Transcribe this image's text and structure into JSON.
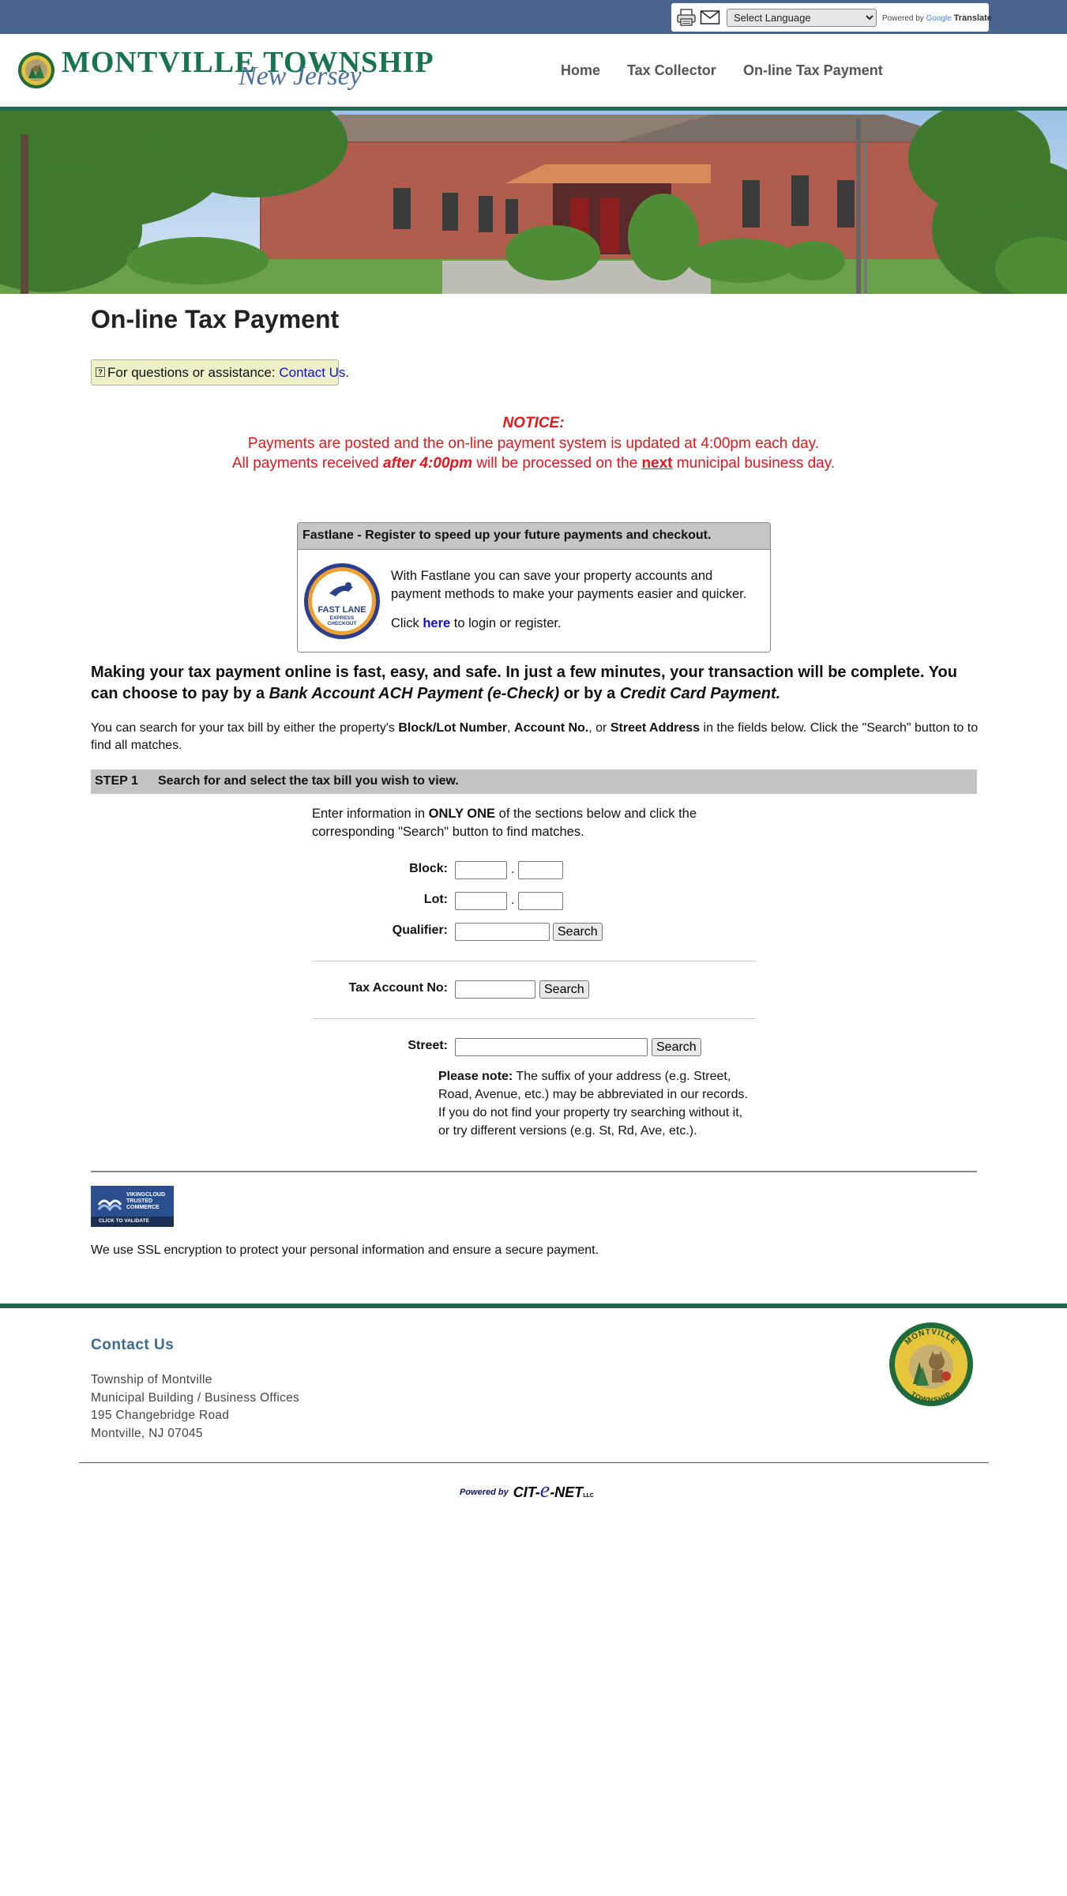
{
  "translate": {
    "language_select": "Select Language",
    "powered_by": "Powered by",
    "google": "Google",
    "translate_label": "Translate"
  },
  "header": {
    "logo_title": "MONTVILLE TOWNSHIP",
    "logo_subtitle": "New Jersey",
    "nav": [
      "Home",
      "Tax Collector",
      "On-line Tax Payment"
    ]
  },
  "page_title": "On-line Tax Payment",
  "help": {
    "icon": "?",
    "text": "For questions or assistance:",
    "link": "Contact Us."
  },
  "notice": {
    "heading": "NOTICE:",
    "line1": "Payments are posted and the on-line payment system is updated at 4:00pm each day.",
    "line2_part1": "All payments received",
    "line2_em": "after 4:00pm",
    "line2_part2": "will be processed on the",
    "line2_next": "next",
    "line2_part3": "municipal business day."
  },
  "fastlane": {
    "heading": "Fastlane - Register to speed up your future payments and checkout.",
    "logo_line1": "FAST LANE",
    "logo_line2": "EXPRESS",
    "logo_line3": "CHECKOUT",
    "body": "With Fastlane you can save your property accounts and payment methods to make your payments easier and quicker.",
    "click_pre": "Click",
    "click_link": "here",
    "click_post": "to login or register."
  },
  "intro": {
    "part1": "Making your tax payment online is fast, easy, and safe. In just a few minutes, your transaction will be complete. You can choose to pay by a",
    "ach": "Bank Account ACH Payment (e-Check)",
    "part2": "or by a",
    "cc": "Credit Card Payment."
  },
  "search_info": {
    "part1": "You can search for your tax bill by either the property's",
    "b1": "Block/Lot Number",
    "part2": ",",
    "b2": "Account No.",
    "part3": ", or",
    "b3": "Street Address",
    "part4": "in the fields below. Click the \"Search\" button to to find all matches."
  },
  "step": {
    "number": "STEP 1",
    "label": "Search for and select the tax bill you wish to view."
  },
  "form": {
    "instr_part1": "Enter information in",
    "instr_bold": "ONLY ONE",
    "instr_part2": "of the sections below and click the corresponding \"Search\" button to find matches.",
    "block_label": "Block:",
    "lot_label": "Lot:",
    "qualifier_label": "Qualifier:",
    "account_label": "Tax Account No:",
    "street_label": "Street:",
    "separator": ".",
    "search_button": "Search",
    "block_value": "",
    "block_suffix_value": "",
    "lot_value": "",
    "lot_suffix_value": "",
    "qualifier_value": "",
    "account_value": "",
    "street_value": "",
    "note_bold": "Please note:",
    "note_text": "The suffix of your address (e.g. Street, Road, Avenue, etc.) may be abbreviated in our records. If you do not find your property try searching without it, or try different versions (e.g. St, Rd, Ave, etc.)."
  },
  "trust_badge": {
    "line1": "VIKINGCLOUD",
    "line2": "TRUSTED",
    "line3": "COMMERCE",
    "validate": "CLICK TO VALIDATE"
  },
  "ssl_text": "We use SSL encryption to protect your personal information and ensure a secure payment.",
  "footer": {
    "contact_title": "Contact Us",
    "address": [
      "Township of Montville",
      "Municipal Building / Business Offices",
      "195 Changebridge Road",
      "Montville, NJ 07045"
    ],
    "seal_top": "MONTVILLE",
    "seal_bottom": "TOWNSHIP",
    "powered_by": "Powered by",
    "brand_cit": "CIT-",
    "brand_e": "e",
    "brand_net": "-NET",
    "brand_llc": "LLC"
  },
  "colors": {
    "topbar": "#49658f",
    "brand_green": "#1f6b54",
    "notice_red": "#e8151b",
    "link_blue": "#1010c8",
    "step_bar": "#c3c3c3"
  }
}
